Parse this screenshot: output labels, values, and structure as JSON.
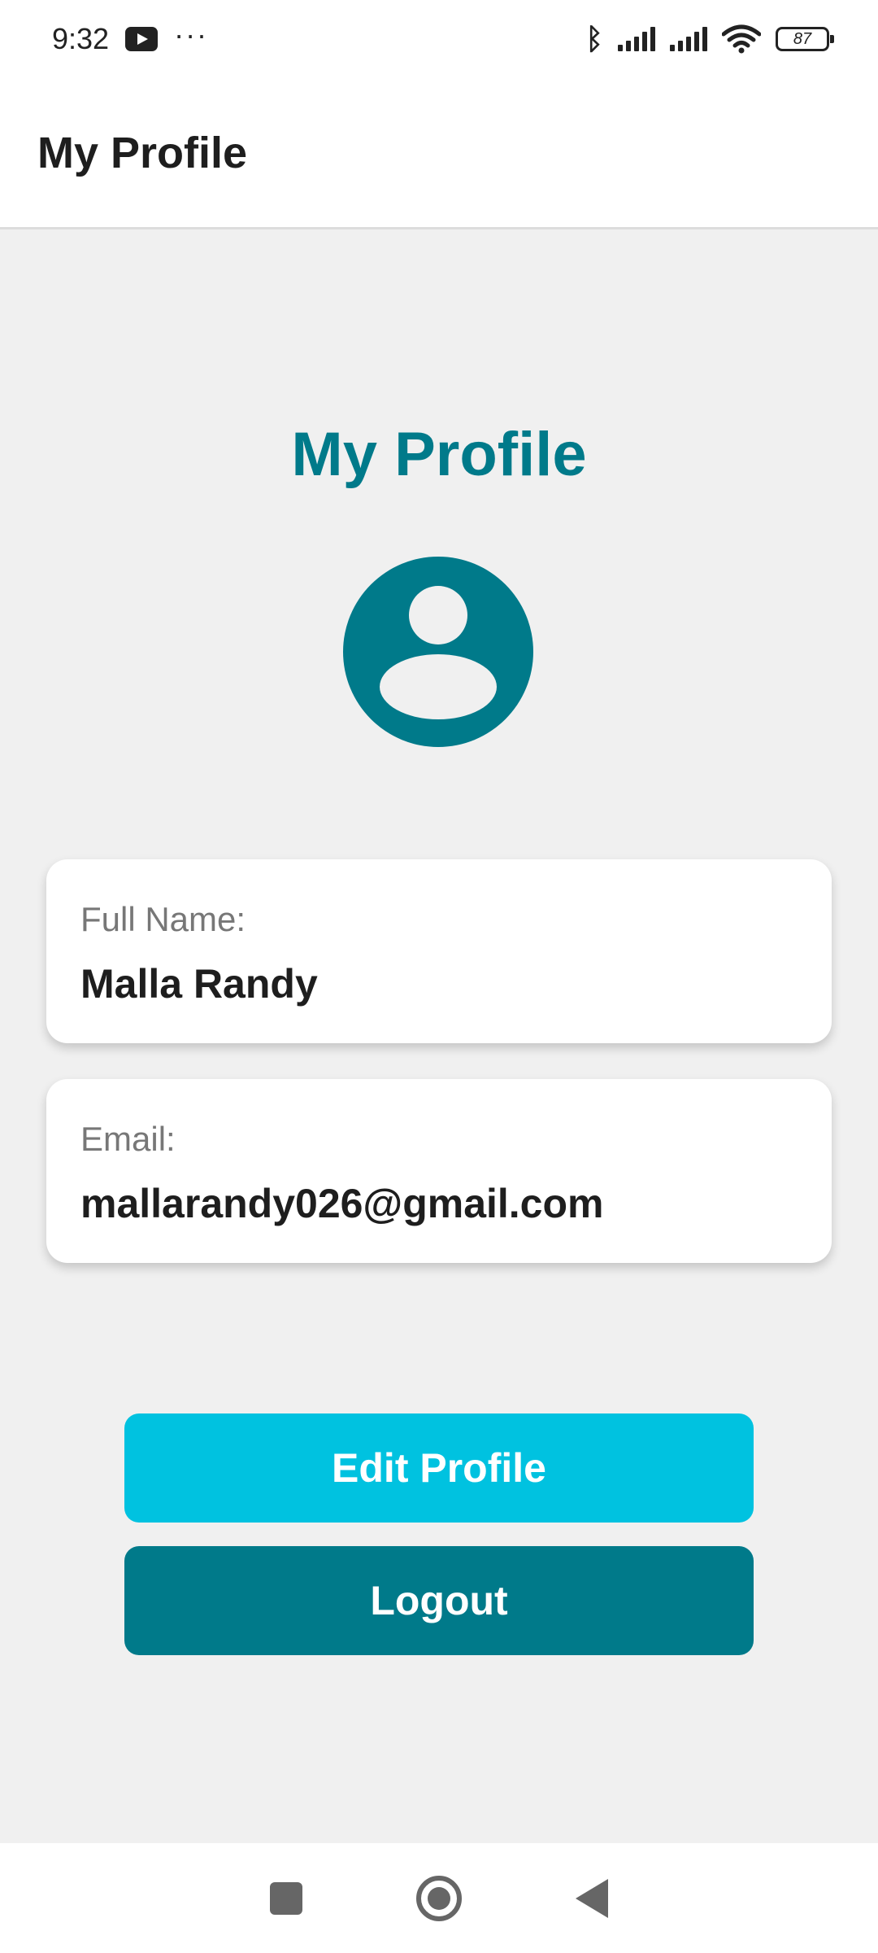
{
  "status_bar": {
    "time": "9:32",
    "battery": "87",
    "icons": [
      "youtube-icon",
      "more-dots-icon",
      "bluetooth-icon",
      "signal-icon",
      "signal-icon",
      "wifi-icon",
      "battery-icon"
    ]
  },
  "app_bar": {
    "title": "My Profile"
  },
  "profile": {
    "heading": "My Profile",
    "avatar_icon": "account-circle-icon",
    "full_name_label": "Full Name:",
    "full_name": "Malla Randy",
    "email_label": "Email:",
    "email": "mallarandy026@gmail.com"
  },
  "actions": {
    "edit_label": "Edit Profile",
    "logout_label": "Logout"
  },
  "colors": {
    "primary": "#007a8a",
    "accent": "#00c2e0",
    "background": "#f0f0f0"
  },
  "nav_bar": {
    "icons": [
      "recents-square-icon",
      "home-circle-icon",
      "back-triangle-icon"
    ]
  }
}
